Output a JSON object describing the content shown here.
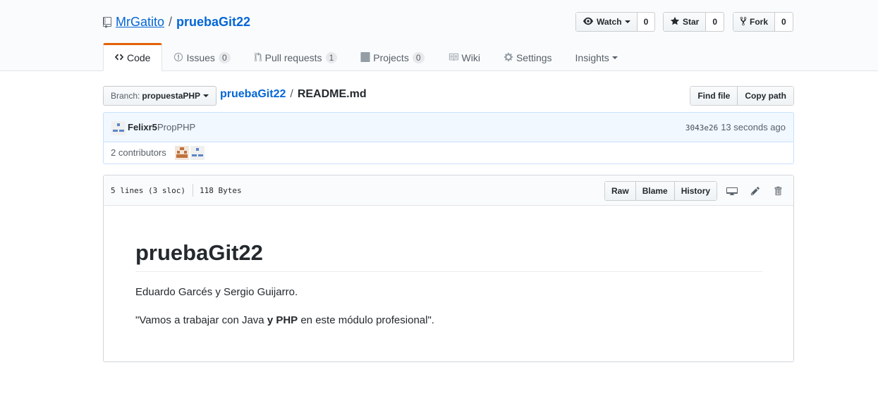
{
  "repo": {
    "owner": "MrGatito",
    "separator": "/",
    "name": "pruebaGit22"
  },
  "actions": {
    "watch_label": "Watch",
    "watch_count": "0",
    "star_label": "Star",
    "star_count": "0",
    "fork_label": "Fork",
    "fork_count": "0"
  },
  "nav": {
    "tabs": [
      {
        "label": "Code"
      },
      {
        "label": "Issues",
        "count": "0"
      },
      {
        "label": "Pull requests",
        "count": "1"
      },
      {
        "label": "Projects",
        "count": "0"
      },
      {
        "label": "Wiki"
      },
      {
        "label": "Settings"
      },
      {
        "label": "Insights"
      }
    ]
  },
  "file_nav": {
    "branch_label": "Branch:",
    "branch_name": "propuestaPHP",
    "breadcrumb_root": "pruebaGit22",
    "breadcrumb_sep": "/",
    "breadcrumb_file": "README.md",
    "find_file": "Find file",
    "copy_path": "Copy path"
  },
  "commit": {
    "author": "Felixr5",
    "message": "PropPHP",
    "sha": "3043e26",
    "time": "13 seconds ago"
  },
  "contributors": {
    "text": "2 contributors"
  },
  "file": {
    "lines": "5 lines (3 sloc)",
    "size": "118 Bytes",
    "raw": "Raw",
    "blame": "Blame",
    "history": "History"
  },
  "readme": {
    "heading": "pruebaGit22",
    "para1": "Eduardo Garcés y Sergio Guijarro.",
    "para2_a": "\"Vamos a trabajar con Java ",
    "para2_bold": "y PHP",
    "para2_b": " en este módulo profesional\"."
  },
  "colors": {
    "link": "#0366d6",
    "tab_accent": "#e36209",
    "commit_bg": "#f1f8ff"
  }
}
